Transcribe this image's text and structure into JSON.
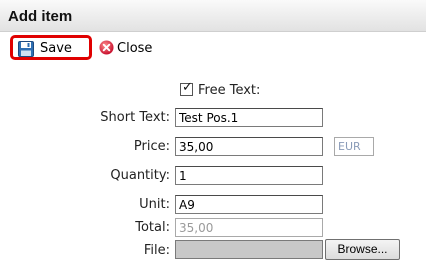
{
  "dialog": {
    "title": "Add item"
  },
  "toolbar": {
    "save_label": "Save",
    "close_label": "Close",
    "save_icon": "floppy-disk-icon",
    "close_icon": "close-circle-icon",
    "highlight_color": "#e00000"
  },
  "form": {
    "free_text": {
      "label": "Free Text:",
      "checked": true,
      "mark": "✓"
    },
    "short_text": {
      "label": "Short Text:",
      "value": "Test Pos.1"
    },
    "price": {
      "label": "Price:",
      "value": "35,00",
      "currency": "EUR"
    },
    "quantity": {
      "label": "Quantity:",
      "value": "1"
    },
    "unit": {
      "label": "Unit:",
      "value": "A9"
    },
    "total": {
      "label": "Total:",
      "value": "35,00"
    },
    "file": {
      "label": "File:",
      "browse_label": "Browse..."
    }
  }
}
